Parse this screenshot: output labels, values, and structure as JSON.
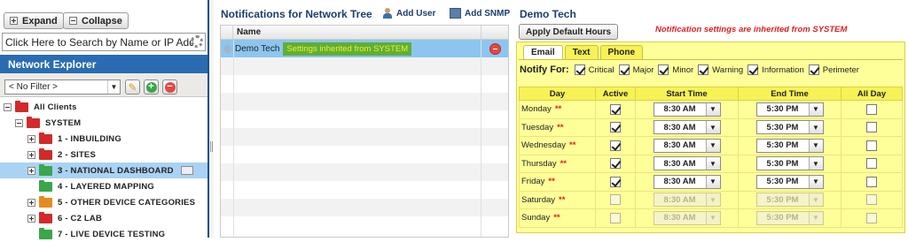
{
  "left": {
    "expand_label": "Expand",
    "collapse_label": "Collapse",
    "search_text": "Click Here to Search by Name or IP Address",
    "panel_title": "Network Explorer",
    "filter_value": "< No Filter >",
    "tree": [
      {
        "label": "All Clients",
        "depth": 0,
        "color": "red"
      },
      {
        "label": "SYSTEM",
        "depth": 1,
        "color": "red"
      },
      {
        "label": "1 - INBUILDING",
        "depth": 2,
        "color": "red"
      },
      {
        "label": "2 - SITES",
        "depth": 2,
        "color": "red"
      },
      {
        "label": "3 - NATIONAL DASHBOARD",
        "depth": 2,
        "color": "green",
        "selected": true
      },
      {
        "label": "4 - LAYERED MAPPING",
        "depth": 2,
        "color": "green"
      },
      {
        "label": "5 - OTHER DEVICE CATEGORIES",
        "depth": 2,
        "color": "orange"
      },
      {
        "label": "6 - C2 LAB",
        "depth": 2,
        "color": "red"
      },
      {
        "label": "7 - LIVE DEVICE TESTING",
        "depth": 2,
        "color": "green"
      }
    ]
  },
  "middle": {
    "title": "Notifications for Network Tree",
    "add_user_label": "Add User",
    "add_snmp_label": "Add SNMP",
    "column_name": "Name",
    "rows": [
      {
        "name": "Demo Tech",
        "badge": "Settings inherited from SYSTEM"
      }
    ]
  },
  "right": {
    "title": "Demo Tech",
    "apply_label": "Apply Default Hours",
    "inherit_message": "Notification settings are inherited from SYSTEM",
    "tabs": [
      "Email",
      "Text",
      "Phone"
    ],
    "active_tab": "Email",
    "notify_label": "Notify For:",
    "notify_options": [
      "Critical",
      "Major",
      "Minor",
      "Warning",
      "Information",
      "Perimeter"
    ],
    "columns": {
      "day": "Day",
      "active": "Active",
      "start": "Start Time",
      "end": "End Time",
      "allday": "All Day"
    },
    "required_marker": "**",
    "schedule": [
      {
        "day": "Monday",
        "active": true,
        "start": "8:30 AM",
        "end": "5:30 PM"
      },
      {
        "day": "Tuesday",
        "active": true,
        "start": "8:30 AM",
        "end": "5:30 PM"
      },
      {
        "day": "Wednesday",
        "active": true,
        "start": "8:30 AM",
        "end": "5:30 PM"
      },
      {
        "day": "Thursday",
        "active": true,
        "start": "8:30 AM",
        "end": "5:30 PM"
      },
      {
        "day": "Friday",
        "active": true,
        "start": "8:30 AM",
        "end": "5:30 PM"
      },
      {
        "day": "Saturday",
        "active": false,
        "start": "8:30 AM",
        "end": "5:30 PM"
      },
      {
        "day": "Sunday",
        "active": false,
        "start": "8:30 AM",
        "end": "5:30 PM"
      }
    ]
  }
}
